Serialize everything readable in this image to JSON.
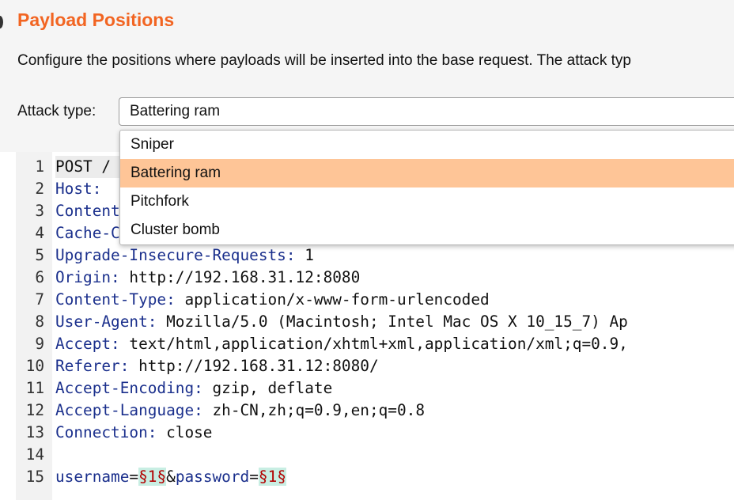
{
  "section": {
    "title": "Payload Positions",
    "description": "Configure the positions where payloads will be inserted into the base request. The attack typ"
  },
  "attack_type": {
    "label": "Attack type:",
    "selected": "Battering ram",
    "options": [
      "Sniper",
      "Battering ram",
      "Pitchfork",
      "Cluster bomb"
    ],
    "highlight_color": "#fec597"
  },
  "request": {
    "lines": [
      {
        "n": "1",
        "text": "POST / "
      },
      {
        "n": "2",
        "name": "Host",
        "sep": ": ",
        "value": ""
      },
      {
        "n": "3",
        "name": "Content-Length",
        "sep": "",
        "value": ""
      },
      {
        "n": "4",
        "name": "Cache-Control",
        "sep": "",
        "value": ""
      },
      {
        "n": "5",
        "name": "Upgrade-Insecure-Requests",
        "sep": ": ",
        "value": "1"
      },
      {
        "n": "6",
        "name": "Origin",
        "sep": ": ",
        "value": "http://192.168.31.12:8080"
      },
      {
        "n": "7",
        "name": "Content-Type",
        "sep": ": ",
        "value": "application/x-www-form-urlencoded"
      },
      {
        "n": "8",
        "name": "User-Agent",
        "sep": ": ",
        "value": "Mozilla/5.0 (Macintosh; Intel Mac OS X 10_15_7) Ap"
      },
      {
        "n": "9",
        "name": "Accept",
        "sep": ": ",
        "value": "text/html,application/xhtml+xml,application/xml;q=0.9,"
      },
      {
        "n": "10",
        "name": "Referer",
        "sep": ": ",
        "value": "http://192.168.31.12:8080/"
      },
      {
        "n": "11",
        "name": "Accept-Encoding",
        "sep": ": ",
        "value": "gzip, deflate"
      },
      {
        "n": "12",
        "name": "Accept-Language",
        "sep": ": ",
        "value": "zh-CN,zh;q=0.9,en;q=0.8"
      },
      {
        "n": "13",
        "name": "Connection",
        "sep": ": ",
        "value": "close"
      },
      {
        "n": "14"
      },
      {
        "n": "15",
        "body": [
          {
            "t": "username",
            "k": "param"
          },
          {
            "t": "=",
            "k": "plain"
          },
          {
            "t": "§1§",
            "k": "payload"
          },
          {
            "t": "&",
            "k": "plain"
          },
          {
            "t": "password",
            "k": "param"
          },
          {
            "t": "=",
            "k": "plain"
          },
          {
            "t": "§1§",
            "k": "payload"
          }
        ]
      }
    ]
  },
  "colors": {
    "title": "#f26522",
    "header_name": "#1a2f8c",
    "payload_marker": "#b30000",
    "payload_bg": "#c8eee3"
  }
}
